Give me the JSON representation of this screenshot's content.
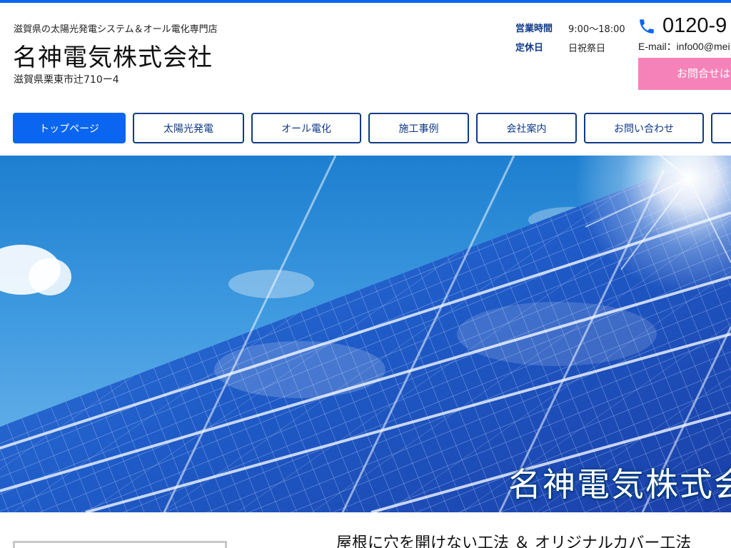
{
  "header": {
    "tagline": "滋賀県の太陽光発電システム＆オール電化専門店",
    "company_name": "名神電気株式会社",
    "address": "滋賀県栗東市辻710ー4",
    "hours_label": "営業時間",
    "hours_value": "9:00〜18:00",
    "holiday_label": "定休日",
    "holiday_value": "日祝祭日",
    "phone": "0120-9",
    "email": "E-mail：info00@mei",
    "contact_button": "お問合せは"
  },
  "nav": {
    "items": [
      {
        "label": "トップページ",
        "active": true
      },
      {
        "label": "太陽光発電"
      },
      {
        "label": "オール電化"
      },
      {
        "label": "施工事例"
      },
      {
        "label": "会社案内"
      },
      {
        "label": "お問い合わせ"
      },
      {
        "label": ""
      }
    ]
  },
  "hero": {
    "title": "名神電気株式会"
  },
  "main": {
    "section_heading": "屋根に穴を開けない工法 ＆ オリジナルカバー工法"
  },
  "colors": {
    "accent_blue": "#0a66f0",
    "navy": "#0f3a86",
    "pink": "#f583b9"
  },
  "icons": {
    "phone": "phone-icon"
  }
}
